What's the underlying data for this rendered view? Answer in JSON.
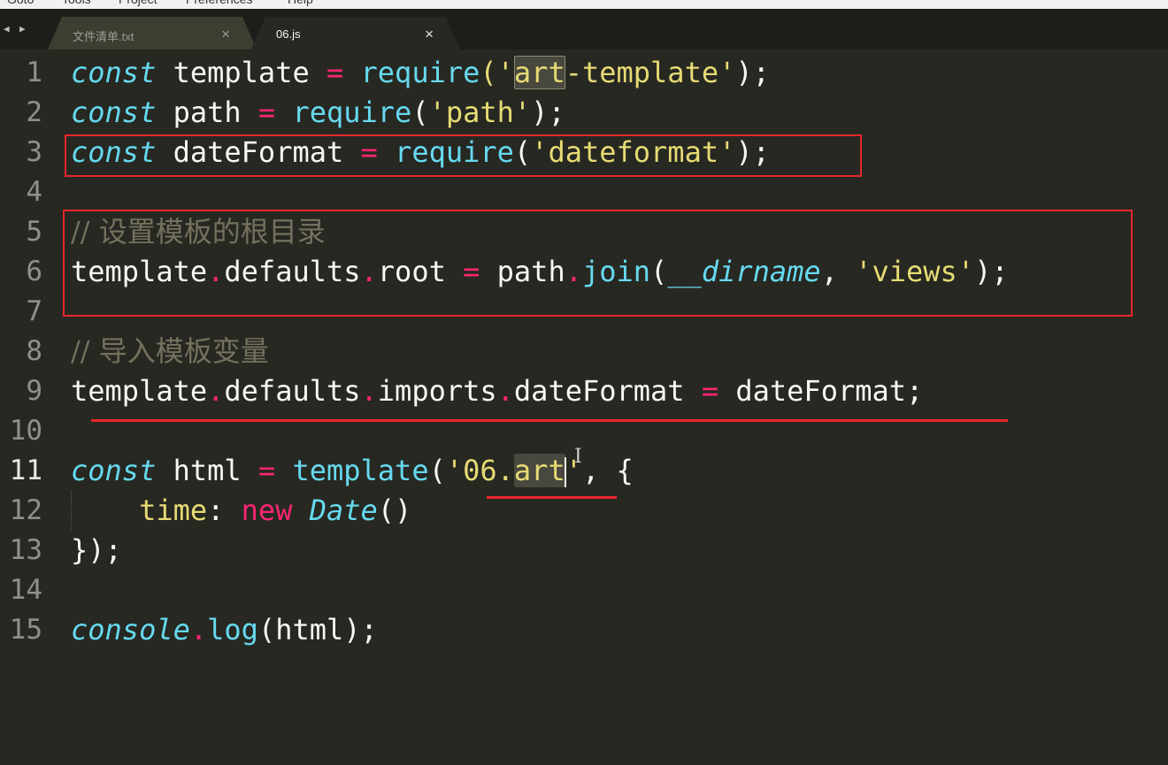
{
  "menu": [
    "Goto",
    "Tools",
    "Project",
    "Preferences",
    "Help"
  ],
  "tabs": [
    {
      "label": "文件清单.txt",
      "close": "×"
    },
    {
      "label": "06.js",
      "close": "×"
    }
  ],
  "nav": {
    "back": "◀",
    "forward": "▶"
  },
  "editor": {
    "line_numbers": [
      "1",
      "2",
      "3",
      "4",
      "5",
      "6",
      "7",
      "8",
      "9",
      "10",
      "11",
      "12",
      "13",
      "14",
      "15"
    ],
    "current_line": "11",
    "lines": {
      "l1": {
        "kw": "const",
        "a": " template ",
        "op": "=",
        "b": " ",
        "fn": "require",
        "c": "('",
        "sel": "art",
        "d": "-template'",
        "e": ");"
      },
      "l2": {
        "kw": "const",
        "a": " path ",
        "op": "=",
        "b": " ",
        "fn": "require",
        "c": "(",
        "str": "'path'",
        "e": ");"
      },
      "l3": {
        "kw": "const",
        "a": " dateFormat ",
        "op": "=",
        "b": " ",
        "fn": "require",
        "c": "(",
        "str": "'dateformat'",
        "e": ");"
      },
      "l5": {
        "comment": "// 设置模板的根目录"
      },
      "l6": {
        "a": "template",
        "d1": ".",
        "b": "defaults",
        "d2": ".",
        "c": "root ",
        "op": "=",
        "e": " path",
        "d3": ".",
        "fn": "join",
        "f": "(",
        "var": "__dirname",
        "g": ", ",
        "str": "'views'",
        "h": ");"
      },
      "l8": {
        "comment": "// 导入模板变量"
      },
      "l9": {
        "a": "template",
        "d1": ".",
        "b": "defaults",
        "d2": ".",
        "c": "imports",
        "d3": ".",
        "e": "dateFormat ",
        "op": "=",
        "f": " dateFormat;"
      },
      "l11": {
        "kw": "const",
        "a": " html ",
        "op": "=",
        "b": " ",
        "fn": "template",
        "c": "(",
        "str1": "'06.",
        "sel": "art",
        "str2": "'",
        "d": ", {"
      },
      "l12": {
        "indent": "    ",
        "prop": "time",
        "colon": ":",
        "sp": " ",
        "new": "new",
        "sp2": " ",
        "cls": "Date",
        "e": "()"
      },
      "l13": {
        "a": "});"
      },
      "l15": {
        "obj": "console",
        "dot": ".",
        "fn": "log",
        "a": "(html);"
      }
    }
  },
  "colors": {
    "background": "#272822",
    "keyword": "#66d9ef",
    "string": "#e6db74",
    "operator": "#f92672",
    "comment": "#75715e",
    "annotation": "#e8262d"
  }
}
